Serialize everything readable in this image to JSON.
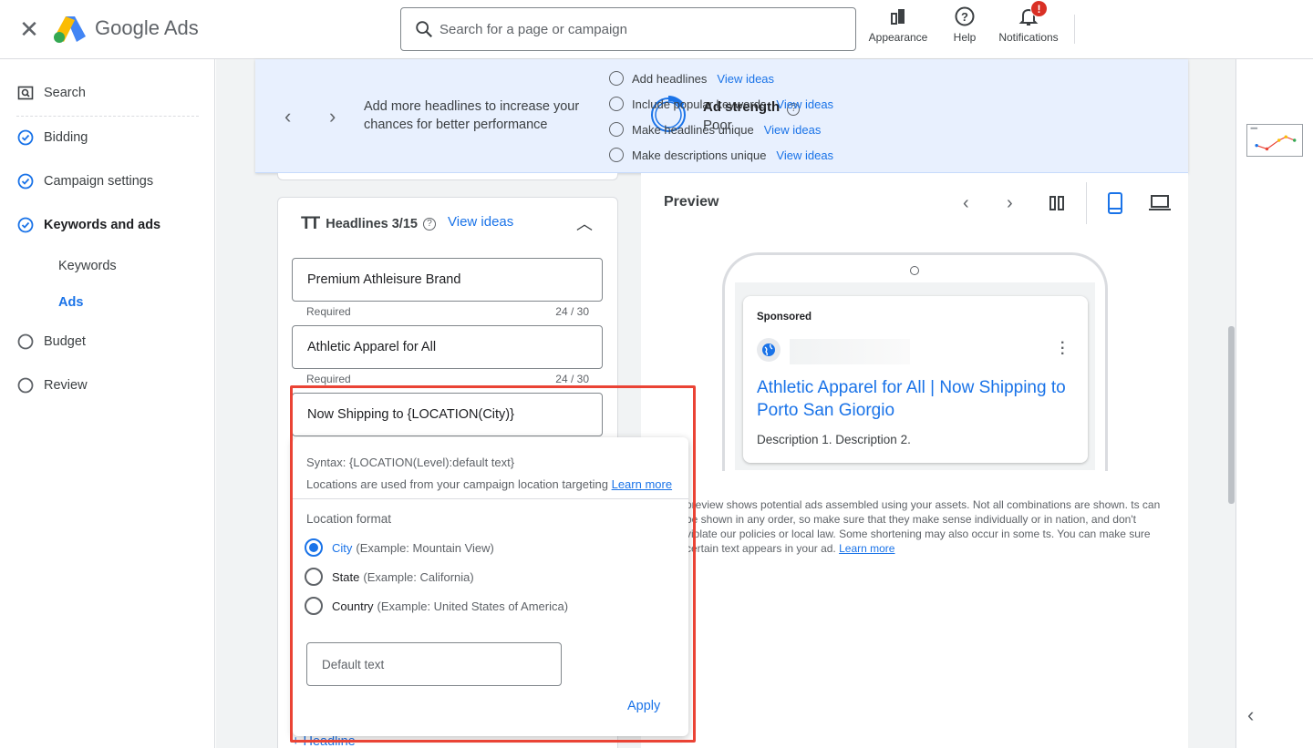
{
  "topbar": {
    "brand": "Google Ads",
    "search_placeholder": "Search for a page or campaign",
    "appearance": "Appearance",
    "help": "Help",
    "notifications": "Notifications",
    "notification_badge": "!"
  },
  "nav": {
    "search": "Search",
    "bidding": "Bidding",
    "campaign_settings": "Campaign settings",
    "keywords_and_ads": "Keywords and ads",
    "keywords": "Keywords",
    "ads": "Ads",
    "budget": "Budget",
    "review": "Review"
  },
  "banner": {
    "message": "Add more headlines to increase your chances for better performance",
    "strength_label": "Ad strength",
    "strength_value": "Poor",
    "tips": [
      {
        "label": "Add headlines",
        "link": "View ideas"
      },
      {
        "label": "Include popular keywords",
        "link": "View ideas"
      },
      {
        "label": "Make headlines unique",
        "link": "View ideas"
      },
      {
        "label": "Make descriptions unique",
        "link": "View ideas"
      }
    ]
  },
  "headlines": {
    "title": "Headlines 3/15",
    "view_ideas": "View ideas",
    "fields": [
      {
        "value": "Premium Athleisure Brand",
        "help": "Required",
        "count": "24 / 30"
      },
      {
        "value": "Athletic Apparel for All",
        "help": "Required",
        "count": "24 / 30"
      },
      {
        "value": "Now Shipping to {LOCATION(City)}"
      }
    ],
    "add_headline": "Headline"
  },
  "popover": {
    "syntax": "Syntax: {LOCATION(Level):default text}",
    "info": "Locations are used from your campaign location targeting",
    "learn_more": "Learn more",
    "location_format": "Location format",
    "options": [
      {
        "label": "City",
        "example": "(Example: Mountain View)",
        "selected": true
      },
      {
        "label": "State",
        "example": "(Example: California)",
        "selected": false
      },
      {
        "label": "Country",
        "example": "(Example: United States of America)",
        "selected": false
      }
    ],
    "default_text_placeholder": "Default text",
    "apply": "Apply"
  },
  "preview": {
    "title": "Preview",
    "ad": {
      "sponsored": "Sponsored",
      "headline": "Athletic Apparel for All | Now Shipping to Porto San Giorgio",
      "description": "Description 1. Description 2."
    },
    "note": "preview shows potential ads assembled using your assets. Not all combinations are shown. ts can be shown in any order, so make sure that they make sense individually or in nation, and don't violate our policies or local law. Some shortening may also occur in some ts. You can make sure certain text appears in your ad.",
    "learn_more": "Learn more"
  },
  "colors": {
    "accent": "#1a73e8",
    "highlight": "#ea4335",
    "banner_bg": "#e8f0fe"
  }
}
